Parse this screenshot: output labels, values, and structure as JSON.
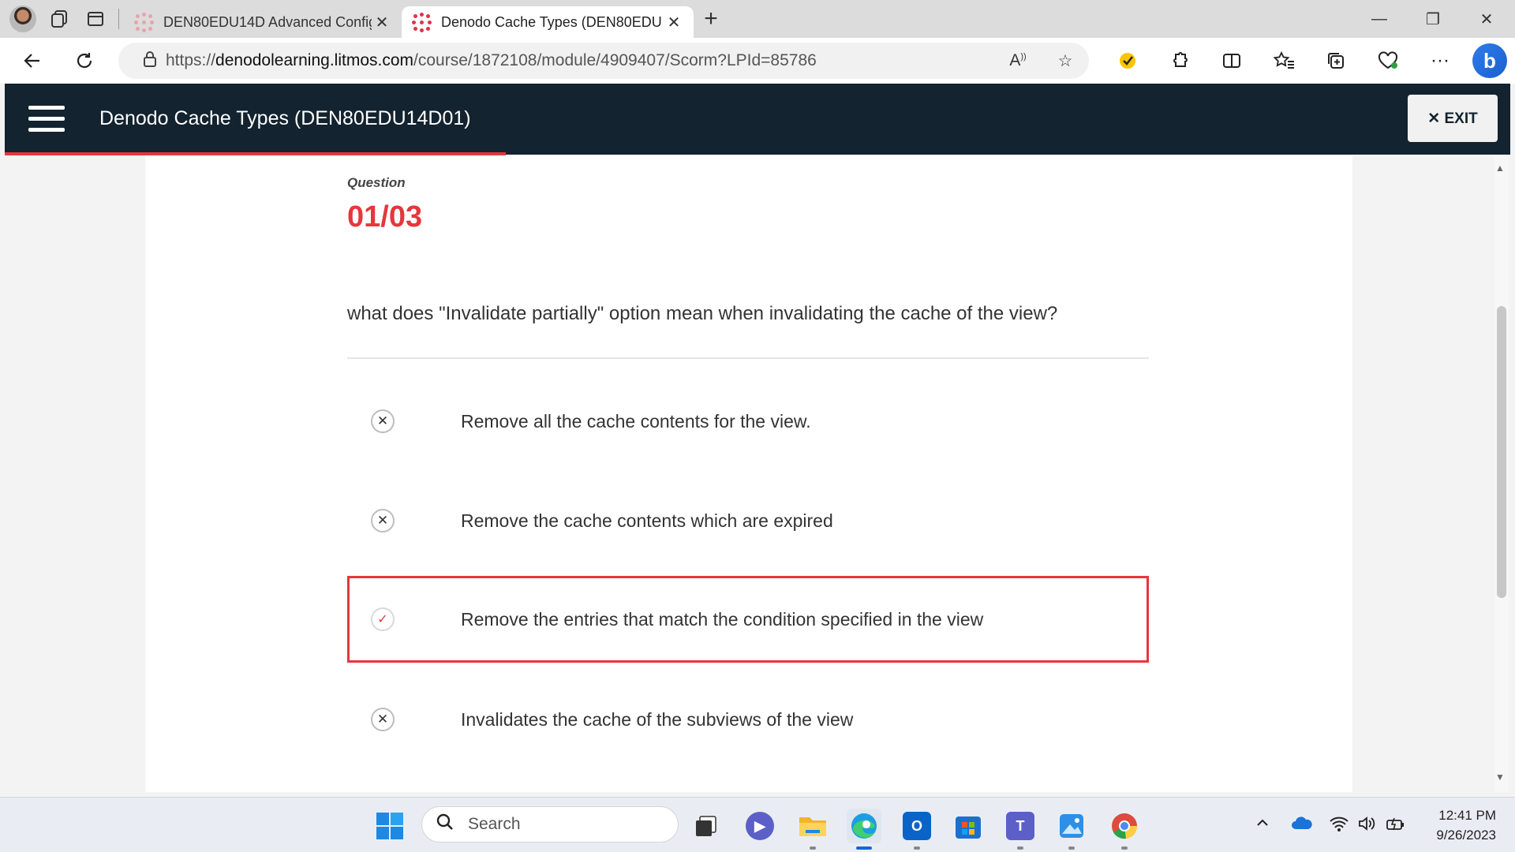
{
  "browser": {
    "tabs": [
      {
        "title": "DEN80EDU14D Advanced Config",
        "close": "✕",
        "active": false
      },
      {
        "title": "Denodo Cache Types (DEN80EDU",
        "close": "✕",
        "active": true
      }
    ],
    "new_tab": "+",
    "window_controls": {
      "minimize": "—",
      "restore": "❐",
      "close": "✕"
    },
    "address": {
      "url_prefix": "https://",
      "url_host": "denodolearning.litmos.com",
      "url_path": "/course/1872108/module/4909407/Scorm?LPId=85786"
    },
    "icons": [
      "back-icon",
      "refresh-icon",
      "lock-icon",
      "read-aloud-icon",
      "favorite-star-icon",
      "norton-icon",
      "extensions-icon",
      "split-screen-icon",
      "favorites-icon",
      "collections-icon",
      "browser-health-icon",
      "more-icon",
      "bing-icon"
    ]
  },
  "app": {
    "course_title": "Denodo Cache Types (DEN80EDU14D01)",
    "exit_label": "✕ EXIT",
    "progress_fraction": 0.333,
    "accent_color": "#e5373d",
    "header_color": "#13232f"
  },
  "question": {
    "label": "Question",
    "number": "01/03",
    "text": "what does \"Invalidate partially\" option mean when invalidating the cache of the view?",
    "answers": [
      {
        "text": "Remove all the cache contents for the view.",
        "mark": "✕",
        "selected": false
      },
      {
        "text": "Remove the cache contents which are expired",
        "mark": "✕",
        "selected": false
      },
      {
        "text": "Remove the entries that match the condition specified in the view",
        "mark": "✓",
        "selected": true
      },
      {
        "text": "Invalidates the cache of the subviews of the view",
        "mark": "✕",
        "selected": false
      }
    ]
  },
  "taskbar": {
    "search_placeholder": "Search",
    "apps": [
      "windows-start-icon",
      "task-view-icon",
      "meet-icon",
      "file-explorer-icon",
      "edge-icon",
      "outlook-icon",
      "store-icon",
      "teams-icon",
      "photos-icon",
      "chrome-icon"
    ],
    "time": "12:41 PM",
    "date": "9/26/2023"
  }
}
